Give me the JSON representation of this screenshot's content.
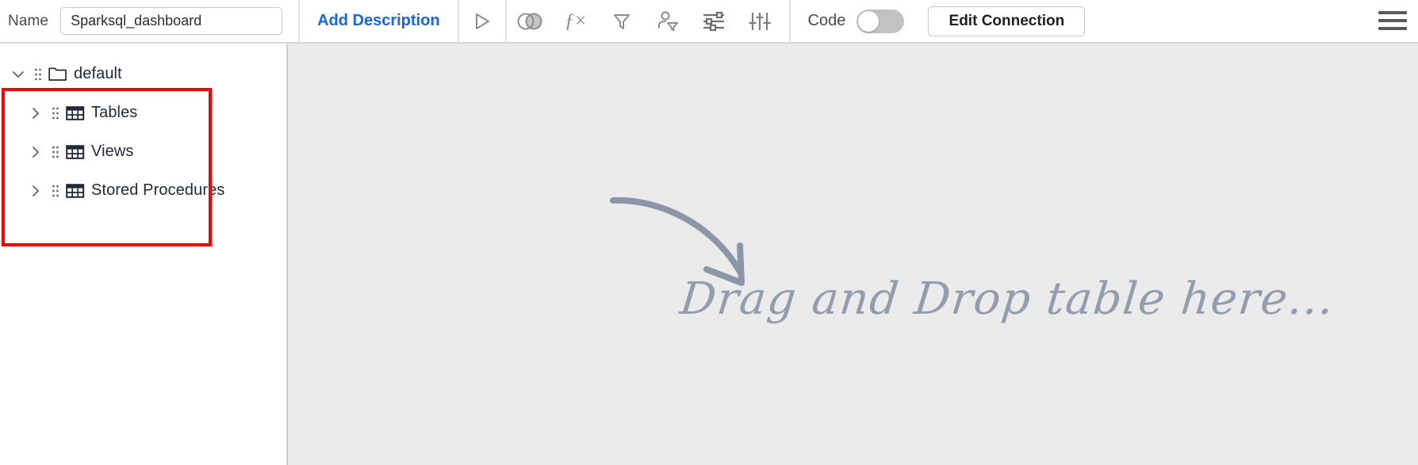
{
  "toolbar": {
    "name_label": "Name",
    "name_value": "Sparksql_dashboard",
    "name_placeholder": "Name",
    "add_description": "Add Description",
    "code_label": "Code",
    "code_toggle_state": "off",
    "edit_connection": "Edit Connection",
    "icons": [
      {
        "name": "run-icon",
        "title": "Run"
      },
      {
        "name": "join-icon",
        "title": "Join"
      },
      {
        "name": "formula-icon",
        "title": "fx",
        "glyph": "ƒ×"
      },
      {
        "name": "filter-icon",
        "title": "Filter"
      },
      {
        "name": "user-filter-icon",
        "title": "User Filter"
      },
      {
        "name": "settings-sliders-icon",
        "title": "Settings"
      },
      {
        "name": "vertical-sliders-icon",
        "title": "Adjustments"
      }
    ],
    "menu_icon": "hamburger-menu-icon"
  },
  "sidebar": {
    "tree": [
      {
        "label": "default",
        "level": 0,
        "expanded": true,
        "chevron": "down",
        "icon": "folder-icon"
      },
      {
        "label": "Tables",
        "level": 1,
        "expanded": false,
        "chevron": "right",
        "icon": "table-icon"
      },
      {
        "label": "Views",
        "level": 1,
        "expanded": false,
        "chevron": "right",
        "icon": "table-icon"
      },
      {
        "label": "Stored Procedures",
        "level": 1,
        "expanded": false,
        "chevron": "right",
        "icon": "table-icon"
      }
    ],
    "highlight_color": "#ff0000"
  },
  "canvas": {
    "drop_hint": "Drag and Drop table here...",
    "arrow_icon": "curved-arrow-icon",
    "background_color": "#ebebeb",
    "hint_color": "#8b97a8"
  }
}
